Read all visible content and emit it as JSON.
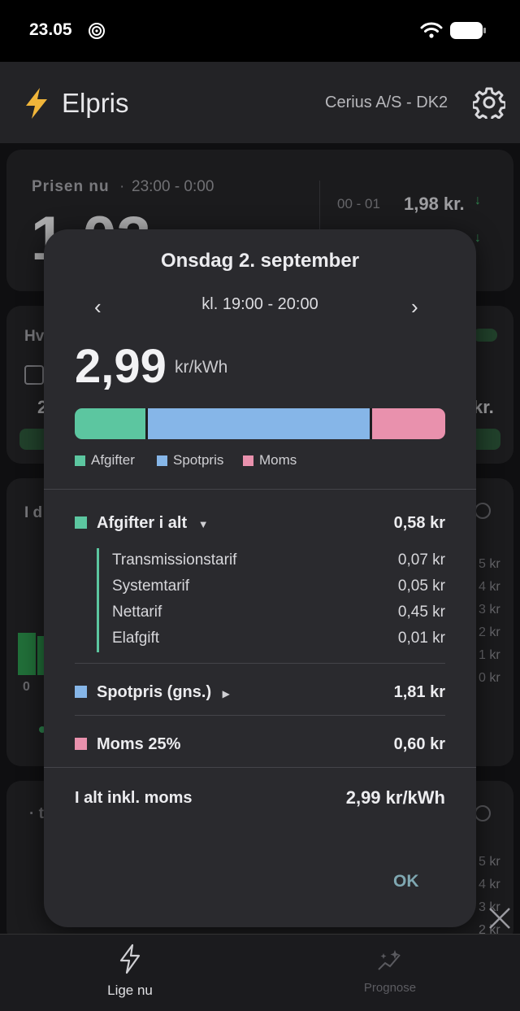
{
  "status_bar": {
    "time": "23.05"
  },
  "header": {
    "title": "Elpris",
    "region": "Cerius A/S - DK2"
  },
  "background": {
    "now_card": {
      "label": "Prisen nu",
      "period": "23:00 - 0:00",
      "price_partial": "1,03",
      "next_hour": "00 - 01",
      "next_price": "1,98 kr."
    },
    "card2_label": "Hv",
    "card2_value": "2",
    "card2_right": "kr.",
    "card3_label": "I d",
    "card3_axis": [
      "5 kr",
      "4 kr",
      "3 kr",
      "2 kr",
      "1 kr",
      "0 kr"
    ],
    "card3_zero": "0",
    "card4_axis": [
      "5 kr",
      "4 kr",
      "3 kr",
      "2 kr"
    ]
  },
  "dialog": {
    "title": "Onsdag 2. september",
    "period": "kl. 19:00 - 20:00",
    "price": "2,99",
    "unit": "kr/kWh",
    "breakdown": [
      {
        "name": "Afgifter",
        "share": 0.194,
        "color": "#5cc6a0"
      },
      {
        "name": "Spotpris",
        "share": 0.605,
        "color": "#86b6e8"
      },
      {
        "name": "Moms",
        "share": 0.201,
        "color": "#e991ad"
      }
    ],
    "afgifter": {
      "label": "Afgifter i alt",
      "value": "0,58 kr",
      "items": [
        {
          "label": "Transmissionstarif",
          "value": "0,07 kr"
        },
        {
          "label": "Systemtarif",
          "value": "0,05 kr"
        },
        {
          "label": "Nettarif",
          "value": "0,45 kr"
        },
        {
          "label": "Elafgift",
          "value": "0,01 kr"
        }
      ]
    },
    "spotpris": {
      "label": "Spotpris (gns.)",
      "value": "1,81 kr"
    },
    "moms": {
      "label": "Moms 25%",
      "value": "0,60 kr"
    },
    "total": {
      "label": "I alt inkl. moms",
      "value": "2,99 kr/kWh"
    },
    "ok_label": "OK"
  },
  "bottom_nav": {
    "tabs": [
      {
        "label": "Lige nu",
        "icon": "lightning-icon",
        "active": true
      },
      {
        "label": "Prognose",
        "icon": "sparkle-icon",
        "active": false
      }
    ]
  }
}
